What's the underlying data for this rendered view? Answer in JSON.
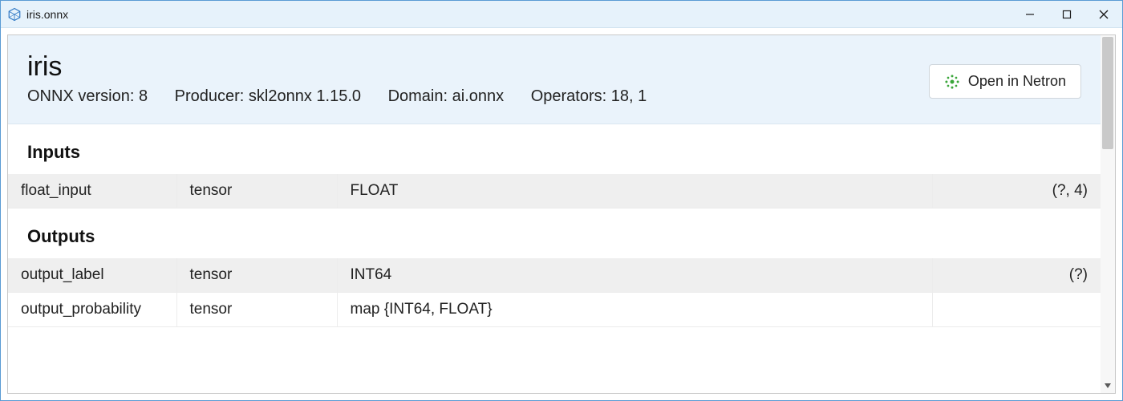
{
  "window": {
    "title": "iris.onnx"
  },
  "header": {
    "model_name": "iris",
    "meta": {
      "onnx_version_label": "ONNX version:",
      "onnx_version_value": "8",
      "producer_label": "Producer:",
      "producer_value": "skl2onnx 1.15.0",
      "domain_label": "Domain:",
      "domain_value": "ai.onnx",
      "operators_label": "Operators:",
      "operators_value": "18, 1"
    },
    "open_button_label": "Open in Netron"
  },
  "sections": {
    "inputs_title": "Inputs",
    "outputs_title": "Outputs"
  },
  "inputs": [
    {
      "name": "float_input",
      "kind": "tensor",
      "dtype": "FLOAT",
      "shape": "(?, 4)"
    }
  ],
  "outputs": [
    {
      "name": "output_label",
      "kind": "tensor",
      "dtype": "INT64",
      "shape": "(?)"
    },
    {
      "name": "output_probability",
      "kind": "tensor",
      "dtype": "map {INT64, FLOAT}",
      "shape": ""
    }
  ]
}
